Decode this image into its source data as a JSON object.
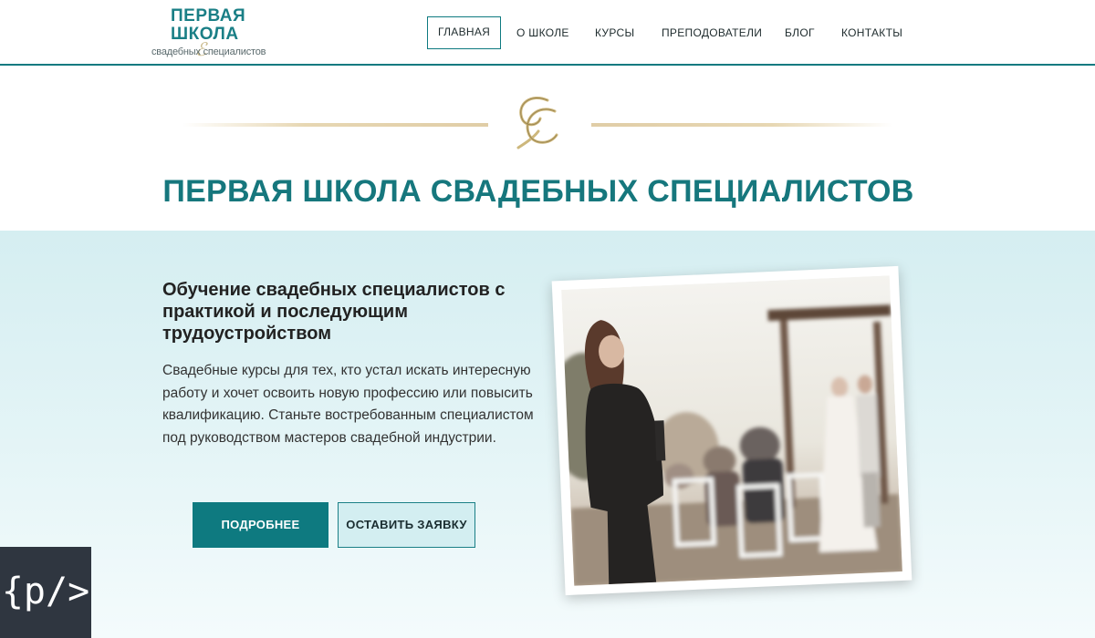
{
  "header": {
    "logo": {
      "line1": "ПЕРВАЯ",
      "line2": "ШКОЛА",
      "line3": "свадебных специалистов"
    },
    "nav": [
      {
        "label": "ГЛАВНАЯ",
        "active": true
      },
      {
        "label": "О ШКОЛЕ"
      },
      {
        "label": "КУРСЫ"
      },
      {
        "label": "ПРЕПОДОВАТЕЛИ"
      },
      {
        "label": "БЛОГ"
      },
      {
        "label": "КОНТАКТЫ"
      }
    ]
  },
  "intro": {
    "title": "ПЕРВАЯ ШКОЛА СВАДЕБНЫХ СПЕЦИАЛИСТОВ"
  },
  "hero": {
    "heading": "Обучение свадебных специалистов с практикой и последующим трудоустройством",
    "text": "Свадебные курсы для тех, кто устал искать интересную работу и хочет освоить новую профессию или повысить квалификацию. Станьте востребованным специалистом под руководством мастеров свадебной индустрии.",
    "buttons": {
      "more": "ПОДРОБНЕЕ",
      "apply": "ОСТАВИТЬ ЗАЯВКУ"
    }
  },
  "badge": {
    "label": "{p/>"
  },
  "colors": {
    "accent": "#0e7a80",
    "title": "#16777d",
    "hero_bg": "#d5eef1",
    "gold": "#c9b98a"
  },
  "icons": {
    "monogram": "cc-monogram-icon",
    "badge": "code-badge-icon"
  }
}
